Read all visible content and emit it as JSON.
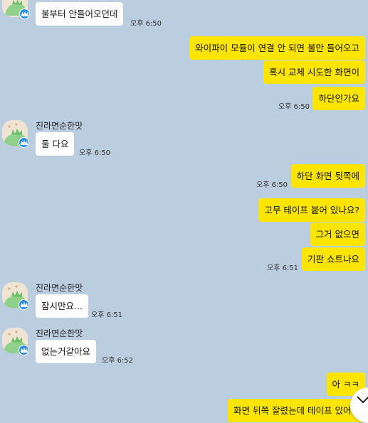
{
  "sender": {
    "name": "진라면순한맛"
  },
  "messages": {
    "m1_text": "불부터 안들어오던데",
    "m1_time": "오후 6:50",
    "m2_text": "와이파이 모듈이 연결 안 되면 불만 들어오고",
    "m3_text": "혹시 교체 시도한 화면이",
    "m4_text": "하단인가요",
    "m4_time": "오후 6:50",
    "m5_text": "둘 다요",
    "m5_time": "오후 6:50",
    "m6_text": "하단 화면 뒷쪽에",
    "m6_time": "오후 6:50",
    "m7_text": "고무 테이프 붙어 있나요?",
    "m8_text": "그거 없으면",
    "m9_text": "기판 쇼트나요",
    "m9_time": "오후 6:51",
    "m10_text": "잠시만요...",
    "m10_time": "오후 6:51",
    "m11_text": "없는거같아요",
    "m11_time": "오후 6:52",
    "m12_text": "아 ㅋㅋ",
    "m13_text": "화면 뒤쪽 잘렸는데 테이프 있어요"
  },
  "icons": {
    "avatar": "dinosaur-avatar-icon",
    "badge": "crown-badge-icon",
    "scroll": "chevron-down-icon"
  },
  "colors": {
    "background": "#bacee0",
    "my_bubble": "#fee500",
    "their_bubble": "#ffffff",
    "badge": "#2f8ee0"
  }
}
